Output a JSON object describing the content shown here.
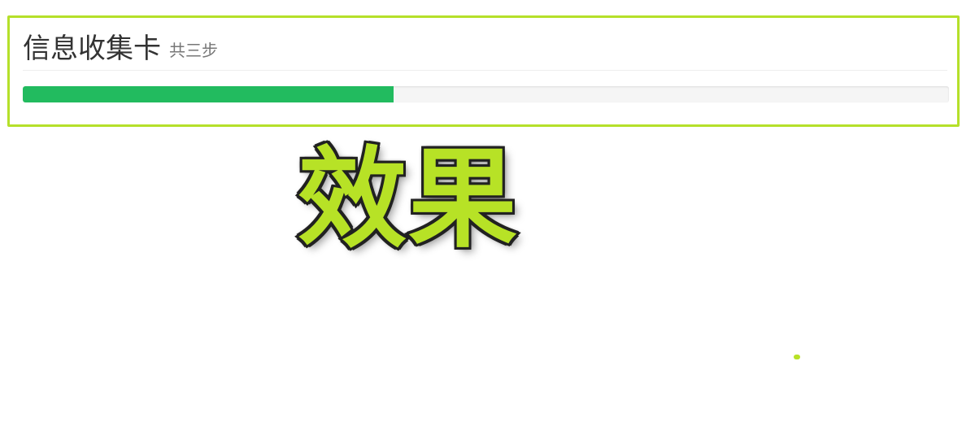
{
  "card": {
    "title": "信息收集卡",
    "subtitle": "共三步",
    "progress_percent": 40,
    "border_color": "#b5e02a",
    "bar_color": "#22bb5f"
  },
  "overlay": {
    "text": "效果",
    "fill_color": "#b7e226",
    "outline_color": "#222222"
  }
}
